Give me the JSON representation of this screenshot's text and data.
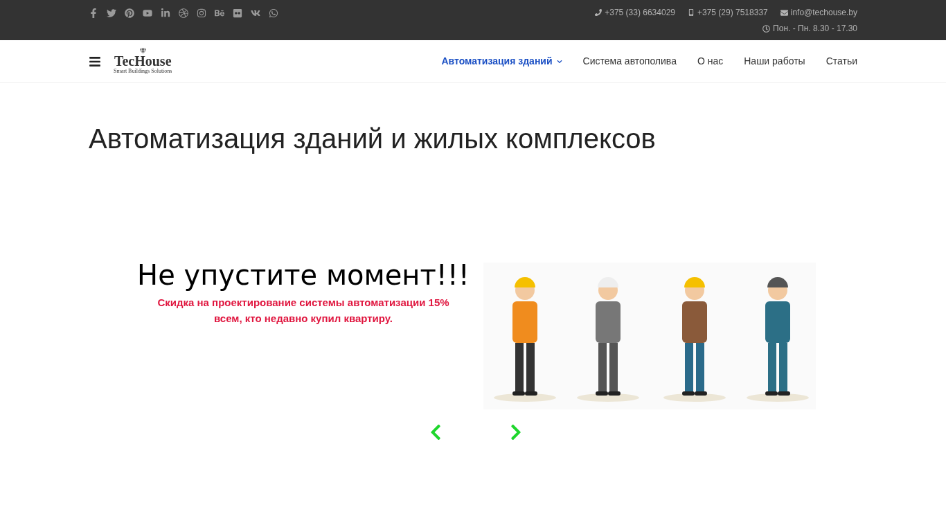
{
  "top_bar": {
    "phone": "+375 (33) 6634029",
    "mobile": "+375 (29) 7518337",
    "email": "info@techouse.by",
    "hours": "Пон. - Пн. 8.30 - 17.30"
  },
  "logo": {
    "name": "TecHouse",
    "tagline": "Smart Buildings Solutions"
  },
  "nav": [
    {
      "label": "Автоматизация зданий",
      "selected": true,
      "dropdown": true
    },
    {
      "label": "Система автополива",
      "selected": false,
      "dropdown": false
    },
    {
      "label": "О нас",
      "selected": false,
      "dropdown": false
    },
    {
      "label": "Наши работы",
      "selected": false,
      "dropdown": false
    },
    {
      "label": "Статьи",
      "selected": false,
      "dropdown": false
    }
  ],
  "page_title": "Автоматизация зданий и жилых комплексов",
  "slide": {
    "title": "Не упустите момент!!!",
    "text": "Скидка на проектирование системы автоматизации 15% всем, кто недавно купил квартиру."
  }
}
